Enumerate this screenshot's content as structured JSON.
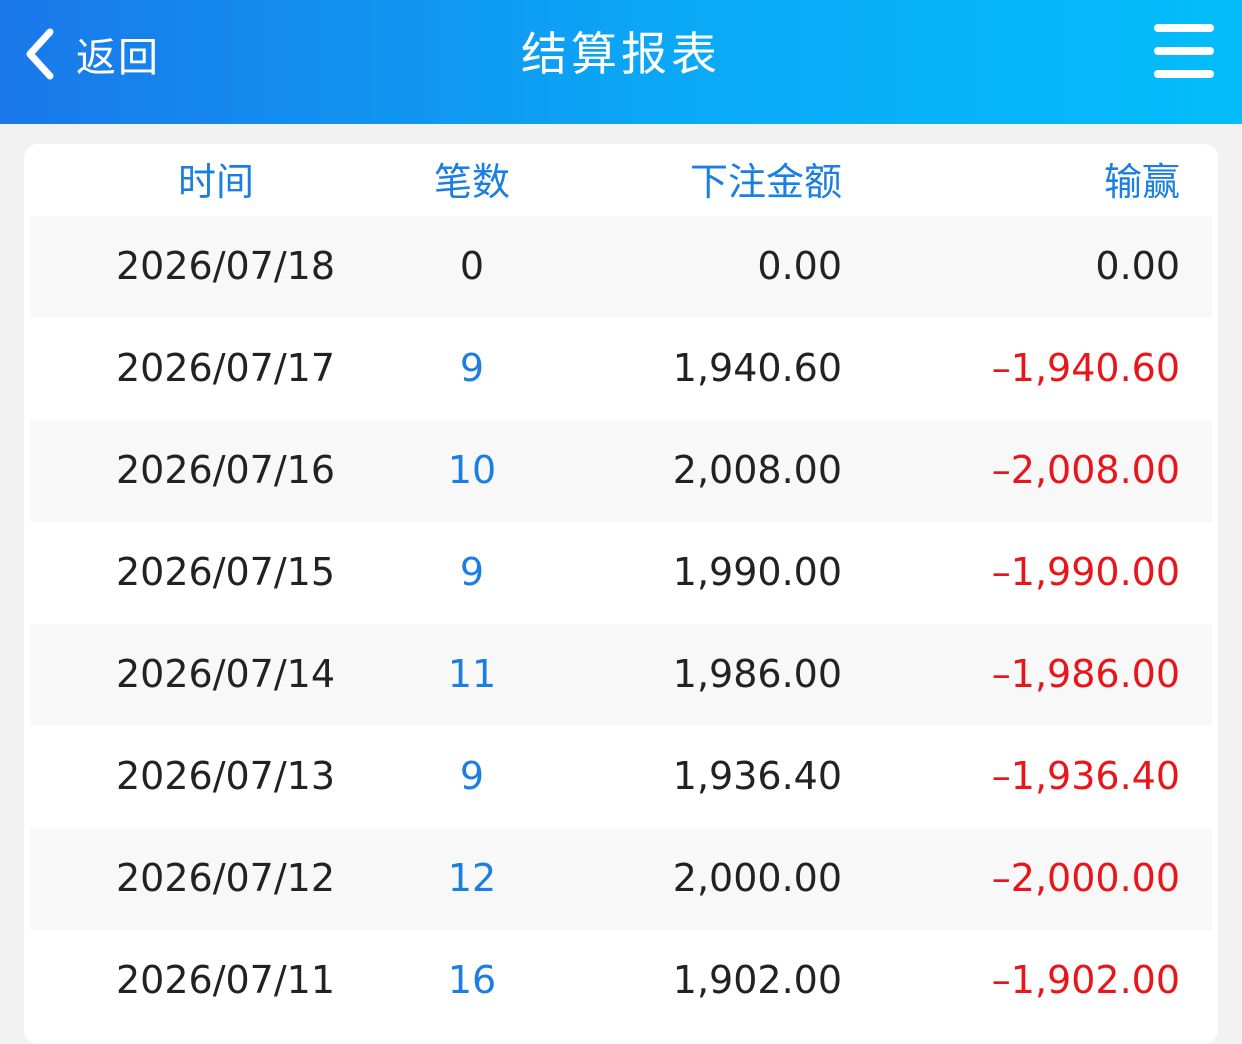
{
  "header": {
    "back_label": "返回",
    "title": "结算报表"
  },
  "colors": {
    "header_start": "#1a78ea",
    "header_end": "#04bdfa",
    "accent_blue": "#1a7fe0",
    "loss_red": "#e8161a"
  },
  "icons": {
    "back": "chevron-left-icon",
    "menu": "hamburger-menu-icon"
  },
  "table": {
    "columns": [
      "时间",
      "笔数",
      "下注金额",
      "输赢"
    ],
    "rows": [
      {
        "date": "2026/07/18",
        "count": "0",
        "amount": "0.00",
        "result": "0.00"
      },
      {
        "date": "2026/07/17",
        "count": "9",
        "amount": "1,940.60",
        "result": "–1,940.60"
      },
      {
        "date": "2026/07/16",
        "count": "10",
        "amount": "2,008.00",
        "result": "–2,008.00"
      },
      {
        "date": "2026/07/15",
        "count": "9",
        "amount": "1,990.00",
        "result": "–1,990.00"
      },
      {
        "date": "2026/07/14",
        "count": "11",
        "amount": "1,986.00",
        "result": "–1,986.00"
      },
      {
        "date": "2026/07/13",
        "count": "9",
        "amount": "1,936.40",
        "result": "–1,936.40"
      },
      {
        "date": "2026/07/12",
        "count": "12",
        "amount": "2,000.00",
        "result": "–2,000.00"
      },
      {
        "date": "2026/07/11",
        "count": "16",
        "amount": "1,902.00",
        "result": "–1,902.00"
      }
    ]
  }
}
